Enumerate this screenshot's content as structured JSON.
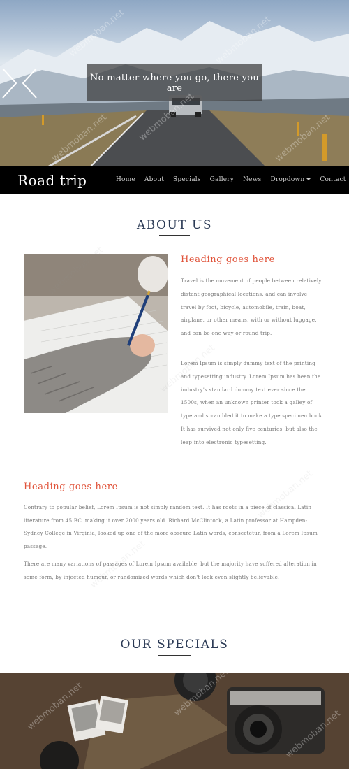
{
  "hero": {
    "caption": "No matter where you go, there you are",
    "watermark": "webmoban.net"
  },
  "nav": {
    "brand": "Road trip",
    "items": [
      "Home",
      "About",
      "Specials",
      "Gallery",
      "News",
      "Dropdown",
      "Contact"
    ]
  },
  "about": {
    "title": "ABOUT US",
    "heading1": "Heading goes here",
    "text1": "Travel is the movement of people between relatively distant geographical locations, and can involve travel by foot, bicycle, automobile, train, boat, airplane, or other means, with or without luggage, and can be one way or round trip.",
    "text2": "Lorem Ipsum is simply dummy text of the printing and typesetting industry. Lorem Ipsum has been the industry's standard dummy text ever since the 1500s, when an unknown printer took a galley of type and scrambled it to make a type specimen book. It has survived not only five centuries, but also the leap into electronic typesetting.",
    "heading2": "Heading goes here",
    "text3": "Contrary to popular belief, Lorem Ipsum is not simply random text. It has roots in a piece of classical Latin literature from 45 BC, making it over 2000 years old. Richard McClintock, a Latin professor at Hampden-Sydney College in Virginia, looked up one of the more obscure Latin words, consectetur, from a Lorem Ipsum passage.",
    "text4": "There are many variations of passages of Lorem Ipsum available, but the majority have suffered alteration in some form, by injected humour, or randomized words which don't look even slightly believable."
  },
  "specials": {
    "title": "OUR SPECIALS"
  },
  "colors": {
    "accent_red": "#e0533a",
    "title_navy": "#2b3a55",
    "nav_bg": "#000000"
  }
}
